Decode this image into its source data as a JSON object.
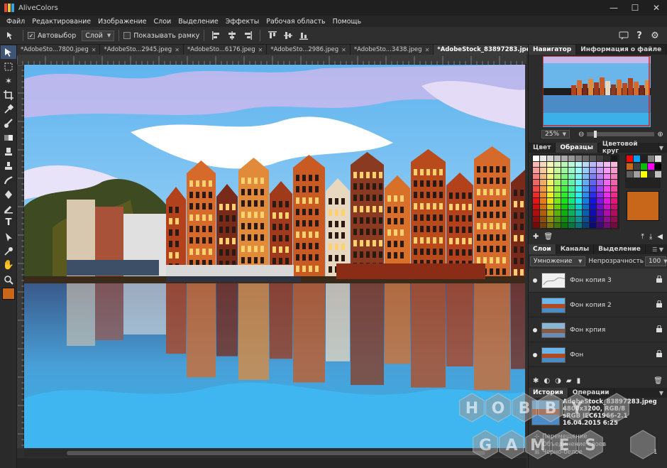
{
  "app": {
    "title": "AliveColors",
    "colors": {
      "accent": "#3f5575",
      "swatch_fg": "#c8661a"
    }
  },
  "menu": [
    "Файл",
    "Редактирование",
    "Изображение",
    "Слои",
    "Выделение",
    "Эффекты",
    "Рабочая область",
    "Помощь"
  ],
  "options": {
    "autoselect_label": "Автовыбор",
    "autoselect_checked": true,
    "layer_select_value": "Слой",
    "show_frame_label": "Показывать рамку"
  },
  "tabs": [
    {
      "label": "*AdobeSto...7800.jpeg",
      "active": false
    },
    {
      "label": "*AdobeSto...2945.jpeg",
      "active": false
    },
    {
      "label": "*AdobeSto...6176.jpeg",
      "active": false
    },
    {
      "label": "*AdobeSto...2986.jpeg",
      "active": false
    },
    {
      "label": "*AdobeSto...3438.jpeg",
      "active": false
    },
    {
      "label": "*AdobeStock_83897283.jpeg",
      "active": true
    }
  ],
  "navigator": {
    "tab_navigator": "Навигатор",
    "tab_fileinfo": "Информация о файле",
    "zoom": "25%"
  },
  "color_panel": {
    "tab_color": "Цвет",
    "tab_samples": "Образцы",
    "tab_wheel": "Цветовой круг"
  },
  "layers_panel": {
    "tab_layers": "Слои",
    "tab_channels": "Каналы",
    "tab_selection": "Выделение",
    "blend_mode": "Умножение",
    "opacity_label": "Непрозрачность",
    "opacity_value": "100",
    "layers": [
      {
        "name": "Фон копия 3",
        "selected": true
      },
      {
        "name": "Фон копия 2",
        "selected": false
      },
      {
        "name": "Фон крпия",
        "selected": false
      },
      {
        "name": "Фон",
        "selected": false
      }
    ]
  },
  "history_panel": {
    "tab_history": "История",
    "tab_operations": "Операции",
    "file_name": "AdobeStock_83897283.jpeg",
    "file_dims": "4800x3200, RGB/8",
    "file_profile": "sRGB IEC61966-2.1",
    "file_date": "16.04.2015 6:25",
    "operations": [
      "Перемещение",
      "Объединение слоев",
      "Черно-белое"
    ],
    "ops_count": "1"
  },
  "watermark": {
    "letters": [
      "H",
      "O",
      "B",
      "B",
      "Y",
      "G",
      "A",
      "M",
      "E",
      "S"
    ]
  }
}
